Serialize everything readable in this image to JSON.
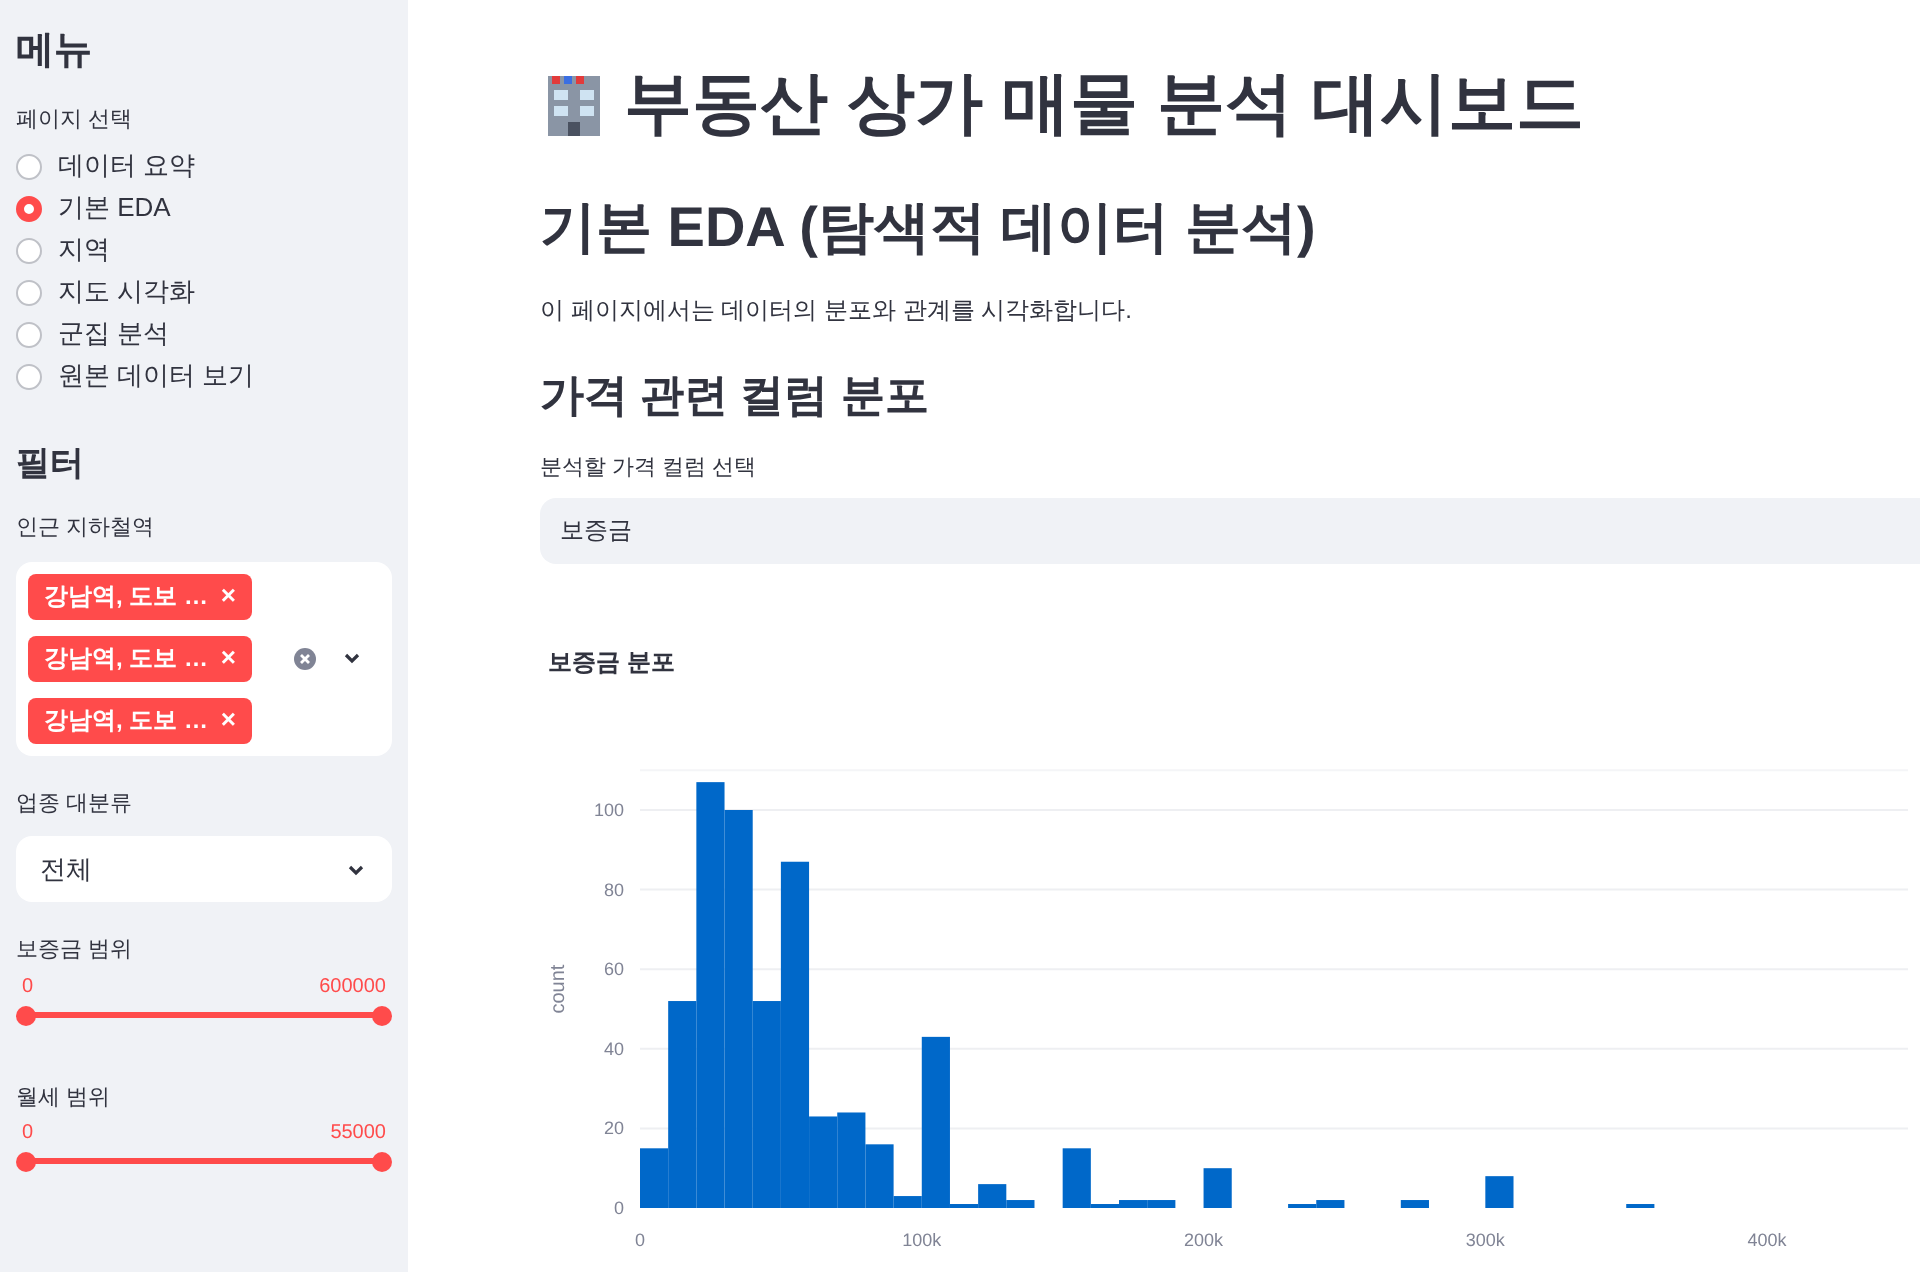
{
  "sidebar": {
    "title": "메뉴",
    "page_select": {
      "label": "페이지 선택",
      "options": [
        {
          "label": "데이터 요약",
          "selected": false
        },
        {
          "label": "기본 EDA",
          "selected": true
        },
        {
          "label": "지역",
          "selected": false
        },
        {
          "label": "지도 시각화",
          "selected": false
        },
        {
          "label": "군집 분석",
          "selected": false
        },
        {
          "label": "원본 데이터 보기",
          "selected": false
        }
      ]
    },
    "filter_title": "필터",
    "stations": {
      "label": "인근 지하철역",
      "tags": [
        "강남역, 도보 …",
        "강남역, 도보 …",
        "강남역, 도보 …"
      ],
      "tag_remove": "×"
    },
    "category": {
      "label": "업종 대분류",
      "value": "전체"
    },
    "sliders": [
      {
        "label": "보증금 범위",
        "min": "0",
        "max": "600000",
        "level": 1
      },
      {
        "label": "월세 범위",
        "min": "0",
        "max": "55000",
        "level": 1
      }
    ]
  },
  "main": {
    "title": "부동산 상가 매물 분석 대시보드",
    "subtitle": "기본 EDA (탐색적 데이터 분석)",
    "description": "이 페이지에서는 데이터의 분포와 관계를 시각화합니다.",
    "section": "가격 관련 컬럼 분포",
    "column_select": {
      "label": "분석할 가격 컬럼 선택",
      "value": "보증금"
    },
    "chart_title": "보증금 분포",
    "chart_data": {
      "type": "bar",
      "ylabel": "count",
      "x": [
        5000,
        15000,
        25000,
        35000,
        45000,
        55000,
        65000,
        75000,
        85000,
        95000,
        105000,
        115000,
        125000,
        135000,
        155000,
        165000,
        175000,
        185000,
        205000,
        235000,
        245000,
        275000,
        305000,
        355000
      ],
      "series": [
        {
          "color": "#0068c9",
          "values": [
            15,
            52,
            107,
            100,
            52,
            87,
            23,
            24,
            16,
            3,
            43,
            1,
            6,
            2,
            15,
            1,
            2,
            2,
            10,
            1,
            2,
            2,
            8,
            1
          ]
        }
      ],
      "xlim": [
        0,
        450000
      ],
      "grid": true,
      "xticks": [
        {
          "value": 0,
          "label": "0"
        },
        {
          "value": 100000,
          "label": "100k"
        },
        {
          "value": 200000,
          "label": "200k"
        },
        {
          "value": 300000,
          "label": "300k"
        },
        {
          "value": 400000,
          "label": "400k"
        }
      ],
      "yticks": [
        0,
        20,
        40,
        60,
        80,
        100
      ],
      "ylim": [
        0,
        110
      ]
    }
  }
}
